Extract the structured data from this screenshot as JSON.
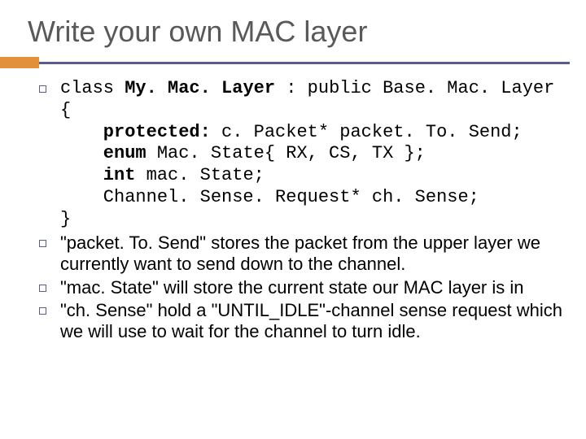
{
  "title": "Write your own MAC layer",
  "items": [
    {
      "type": "code",
      "code": {
        "line1_a": "class ",
        "line1_b": "My. Mac. Layer",
        "line1_c": " : public Base. Mac. Layer",
        "line2": "{",
        "line3_a": "    protected:",
        "line3_b": " c. Packet* packet. To. Send;",
        "line4_a": "    enum",
        "line4_b": " Mac. State{ RX, CS, TX };",
        "line5_a": "    int",
        "line5_b": " mac. State;",
        "line6": "    Channel. Sense. Request* ch. Sense;",
        "line7": "}"
      }
    },
    {
      "type": "text",
      "text": "\"packet. To. Send\" stores the packet from the upper layer we currently want to send down to the channel."
    },
    {
      "type": "text",
      "text": "\"mac. State\" will store the current state our MAC layer is in"
    },
    {
      "type": "text",
      "text": "\"ch. Sense\" hold a \"UNTIL_IDLE\"-channel sense request which we will use to wait for the channel to turn idle."
    }
  ]
}
